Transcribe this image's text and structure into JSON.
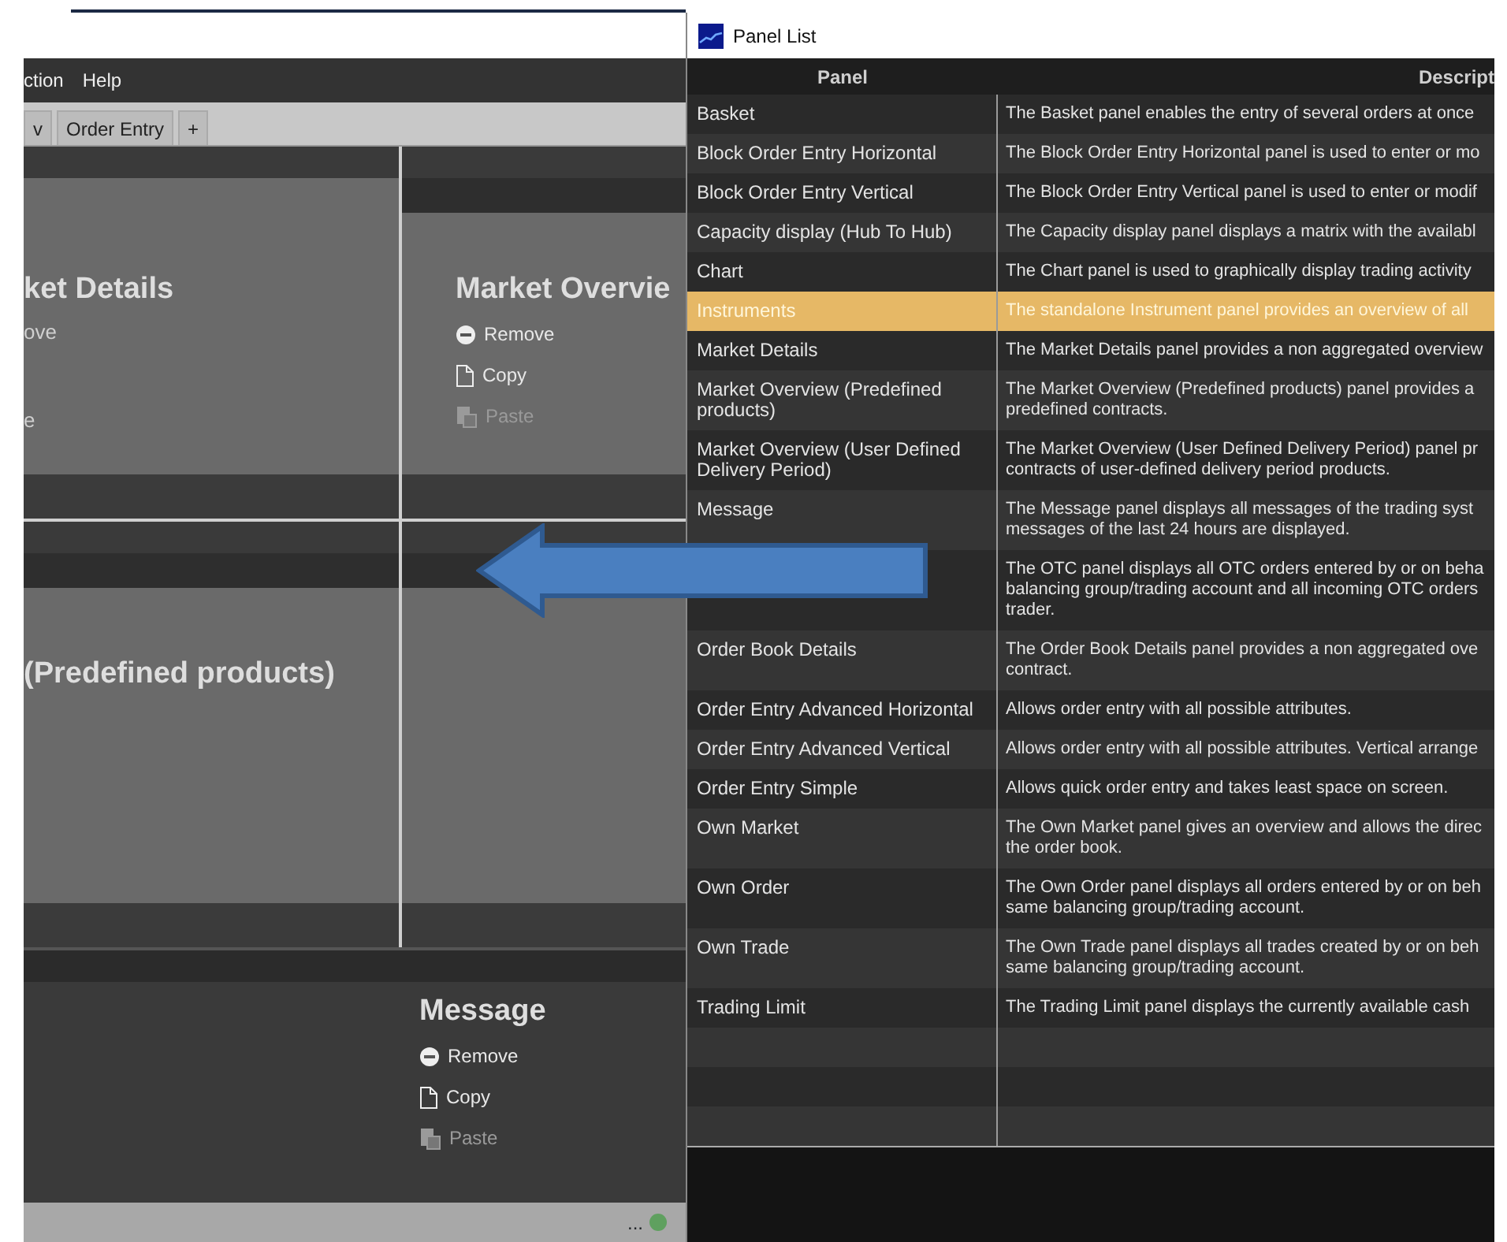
{
  "app": {
    "menu": [
      "ction",
      "Help"
    ],
    "tabs": [
      {
        "label": "v"
      },
      {
        "label": "Order Entry"
      }
    ],
    "add_tab": "+",
    "panels": [
      {
        "title": "ket Details",
        "lines": [
          "ove",
          "e"
        ]
      },
      {
        "title": "Market Overvie",
        "menu": [
          {
            "label": "Remove",
            "kind": "remove",
            "disabled": false
          },
          {
            "label": "Copy",
            "kind": "copy",
            "disabled": false
          },
          {
            "label": "Paste",
            "kind": "paste",
            "disabled": true
          }
        ]
      },
      {
        "title": "(Predefined products)"
      },
      {
        "title": "Message",
        "menu": [
          {
            "label": "Remove",
            "kind": "remove",
            "disabled": false
          },
          {
            "label": "Copy",
            "kind": "copy",
            "disabled": false
          },
          {
            "label": "Paste",
            "kind": "paste",
            "disabled": true
          }
        ]
      }
    ],
    "status": "..."
  },
  "panel_list": {
    "title": "Panel List",
    "columns": [
      "Panel",
      "Descript"
    ],
    "rows": [
      {
        "panel": "Basket",
        "description": "The Basket panel enables the entry of several orders at once",
        "selected": false
      },
      {
        "panel": "Block Order Entry Horizontal",
        "description": "The Block Order Entry Horizontal panel is used to enter or mo",
        "selected": false
      },
      {
        "panel": "Block Order Entry Vertical",
        "description": "The Block Order Entry Vertical panel is used to enter or modif",
        "selected": false
      },
      {
        "panel": "Capacity display (Hub To Hub)",
        "description": "The Capacity display panel displays a matrix with the availabl",
        "selected": false
      },
      {
        "panel": "Chart",
        "description": "The Chart panel is used to graphically display trading activity",
        "selected": false
      },
      {
        "panel": "Instruments",
        "description": "The standalone Instrument panel provides an overview of all",
        "selected": true
      },
      {
        "panel": "Market Details",
        "description": "The Market Details panel provides a non aggregated overview",
        "selected": false
      },
      {
        "panel": "Market Overview (Predefined products)",
        "description": "The Market Overview (Predefined products) panel provides a\npredefined contracts.",
        "selected": false
      },
      {
        "panel": "Market Overview (User Defined Delivery Period)",
        "description": "The Market Overview (User Defined Delivery Period) panel pr\ncontracts of user-defined delivery period products.",
        "selected": false
      },
      {
        "panel": "Message",
        "description": "The Message panel displays all messages of the trading syst\nmessages of the last 24 hours are displayed.",
        "selected": false
      },
      {
        "description": "The OTC panel displays all OTC orders entered by or on beha\nbalancing group/trading account and all incoming OTC orders\ntrader.",
        "selected": false
      },
      {
        "panel": "Order Book Details",
        "description": "The Order Book Details panel provides a non aggregated ove\ncontract.",
        "selected": false
      },
      {
        "panel": "Order Entry Advanced Horizontal",
        "description": "Allows order entry with all possible attributes.",
        "selected": false
      },
      {
        "panel": "Order Entry Advanced Vertical",
        "description": "Allows order entry with all possible attributes. Vertical arrange",
        "selected": false
      },
      {
        "panel": "Order Entry Simple",
        "description": "Allows quick order entry and takes least space on screen.",
        "selected": false
      },
      {
        "panel": "Own Market",
        "description": "The Own Market panel gives an overview and allows the direc\nthe order book.",
        "selected": false
      },
      {
        "panel": "Own Order",
        "description": "The Own Order panel displays all orders entered by or on beh\nsame balancing group/trading account.",
        "selected": false
      },
      {
        "panel": "Own Trade",
        "description": "The Own Trade panel displays all trades created by or on beh\nsame balancing group/trading account.",
        "selected": false
      },
      {
        "panel": "Trading Limit",
        "description": "The Trading Limit panel displays the currently available cash",
        "selected": false
      }
    ]
  }
}
